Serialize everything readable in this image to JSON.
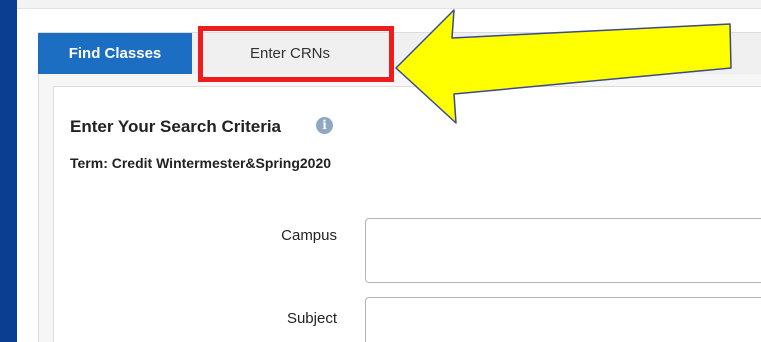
{
  "tabs": [
    {
      "label": "Find Classes",
      "active": true
    },
    {
      "label": "Enter CRNs",
      "active": false
    }
  ],
  "search": {
    "heading": "Enter Your Search Criteria",
    "info_icon": "info-icon",
    "term": "Term: Credit Wintermester&Spring2020"
  },
  "fields": {
    "campus_label": "Campus",
    "subject_label": "Subject"
  },
  "annotation": {
    "highlight_color": "#ee1c1c",
    "arrow_color": "#ffff00"
  },
  "colors": {
    "active_tab": "#1b6ec2",
    "left_bar": "#0b3d91"
  }
}
